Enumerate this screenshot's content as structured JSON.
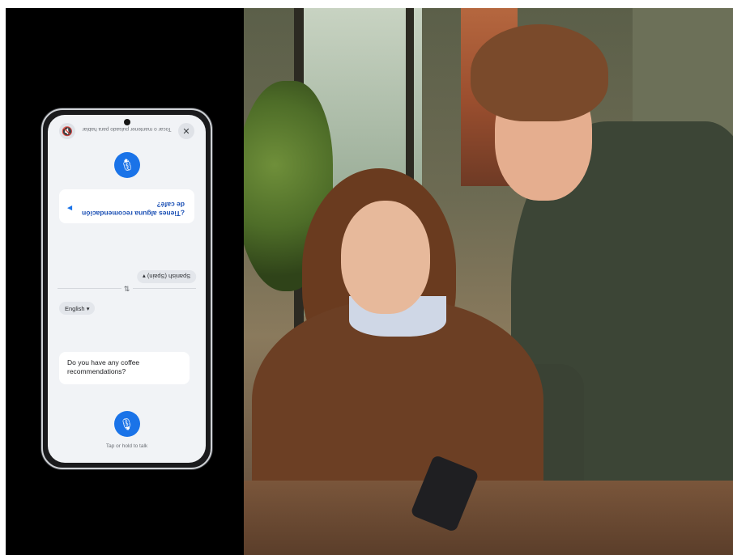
{
  "translator": {
    "top_hint": "Tocar o mantener pulsado para hablar",
    "mute_icon": "speaker-muted-icon",
    "close_icon": "close-icon",
    "mic_icon": "microphone-icon",
    "translated_text": "¿Tienes alguna recomendación de café?",
    "speak_icon": "speaker-play-icon",
    "target_language": "Spanish (Spain)",
    "swap_icon": "swap-vertical-icon",
    "source_language": "English",
    "source_text": "Do you have any coffee recommendations?",
    "bottom_hint": "Tap or hold to talk",
    "accent_color": "#1a73e8"
  }
}
